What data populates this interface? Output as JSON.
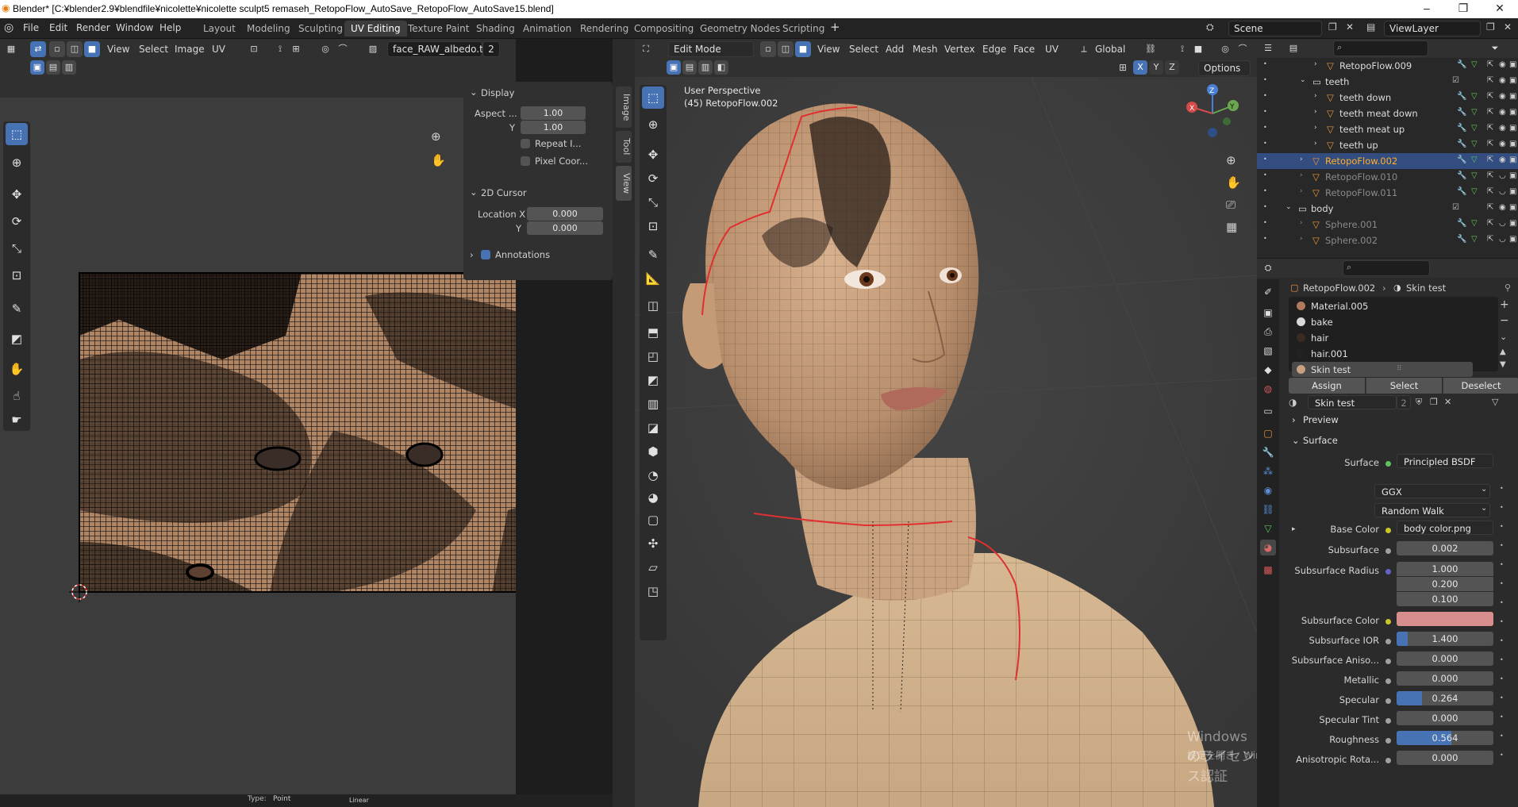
{
  "window": {
    "title": "Blender* [C:¥blender2.9¥blendfile¥nicolette¥nicolette sculpt5 remaseh_RetopoFlow_AutoSave_RetopoFlow_AutoSave15.blend]",
    "minimize": "–",
    "maximize": "❐",
    "close": "✕"
  },
  "menu": {
    "items": [
      "File",
      "Edit",
      "Render",
      "Window",
      "Help"
    ]
  },
  "workspaces": {
    "tabs": [
      "Layout",
      "Modeling",
      "Sculpting",
      "UV Editing",
      "Texture Paint",
      "Shading",
      "Animation",
      "Rendering",
      "Compositing",
      "Geometry Nodes",
      "Scripting"
    ],
    "active": "UV Editing",
    "add": "+"
  },
  "scene": {
    "name": "Scene",
    "view_layer": "ViewLayer"
  },
  "uv_editor": {
    "menus": [
      "View",
      "Select",
      "Image",
      "UV"
    ],
    "image_name": "face_RAW_albedo.tif",
    "users": "2",
    "side_tabs": [
      "Image",
      "Tool",
      "View"
    ],
    "display": {
      "header": "Display",
      "aspect_label": "Aspect ...",
      "aspect_x": "1.00",
      "y_label": "Y",
      "aspect_y": "1.00",
      "repeat_label": "Repeat I...",
      "pixel_label": "Pixel Coor..."
    },
    "cursor": {
      "header": "2D Cursor",
      "loc_x_label": "Location X",
      "loc_x": "0.000",
      "y_label": "Y",
      "loc_y": "0.000"
    },
    "annotations": "Annotations",
    "footer": {
      "type_label": "Type:",
      "type_value": "Point",
      "interp": "Linear"
    }
  },
  "viewport": {
    "mode": "Edit Mode",
    "menus": [
      "View",
      "Select",
      "Add",
      "Mesh",
      "Vertex",
      "Edge",
      "Face",
      "UV"
    ],
    "transform": "Global",
    "axes": [
      "X",
      "Y",
      "Z"
    ],
    "options": "Options",
    "perspective": "User Perspective",
    "object": "(45) RetopoFlow.002"
  },
  "outliner": {
    "rows": [
      {
        "label": "RetopoFlow.009",
        "depth": 3,
        "style": "normal"
      },
      {
        "label": "teeth",
        "depth": 2,
        "style": "collection"
      },
      {
        "label": "teeth down",
        "depth": 3,
        "style": "normal"
      },
      {
        "label": "teeth meat down",
        "depth": 3,
        "style": "normal"
      },
      {
        "label": "teeth meat up",
        "depth": 3,
        "style": "normal"
      },
      {
        "label": "teeth up",
        "depth": 3,
        "style": "normal"
      },
      {
        "label": "RetopoFlow.002",
        "depth": 2,
        "style": "selected"
      },
      {
        "label": "RetopoFlow.010",
        "depth": 2,
        "style": "dim"
      },
      {
        "label": "RetopoFlow.011",
        "depth": 2,
        "style": "dim"
      },
      {
        "label": "body",
        "depth": 1,
        "style": "collection"
      },
      {
        "label": "Sphere.001",
        "depth": 2,
        "style": "dim"
      },
      {
        "label": "Sphere.002",
        "depth": 2,
        "style": "dim"
      }
    ]
  },
  "properties": {
    "breadcrumb_object": "RetopoFlow.002",
    "breadcrumb_material": "Skin test",
    "materials": [
      "Material.005",
      "bake",
      "hair",
      "hair.001",
      "Skin test"
    ],
    "selected_material": "Skin test",
    "assign": "Assign",
    "select": "Select",
    "deselect": "Deselect",
    "material_name": "Skin test",
    "material_users": "2",
    "preview": "Preview",
    "surface_section": "Surface",
    "surface_label": "Surface",
    "surface_value": "Principled BSDF",
    "distribution": "GGX",
    "subsurface_method": "Random Walk",
    "base_color_label": "Base Color",
    "base_color_value": "body color.png",
    "subsurface_label": "Subsurface",
    "subsurface_value": "0.002",
    "ss_radius_label": "Subsurface Radius",
    "ss_radius": [
      "1.000",
      "0.200",
      "0.100"
    ],
    "ss_color_label": "Subsurface Color",
    "ss_color": "#d98e8e",
    "ss_ior_label": "Subsurface IOR",
    "ss_ior_value": "1.400",
    "ss_aniso_label": "Subsurface Aniso...",
    "ss_aniso_value": "0.000",
    "metallic_label": "Metallic",
    "metallic_value": "0.000",
    "specular_label": "Specular",
    "specular_value": "0.264",
    "specular_fill": 0.264,
    "spec_tint_label": "Specular Tint",
    "spec_tint_value": "0.000",
    "roughness_label": "Roughness",
    "roughness_value": "0.564",
    "roughness_fill": 0.564,
    "aniso_label": "Anisotropic Rota...",
    "aniso_value": "0.000"
  },
  "watermark": {
    "line1": "Windows のライセンス認証",
    "line2": "設定を開き、Windows のライセンス認証を行ってください。"
  },
  "colors": {
    "accent": "#4772b3",
    "selection": "#334d80",
    "seam": "#e03030"
  }
}
